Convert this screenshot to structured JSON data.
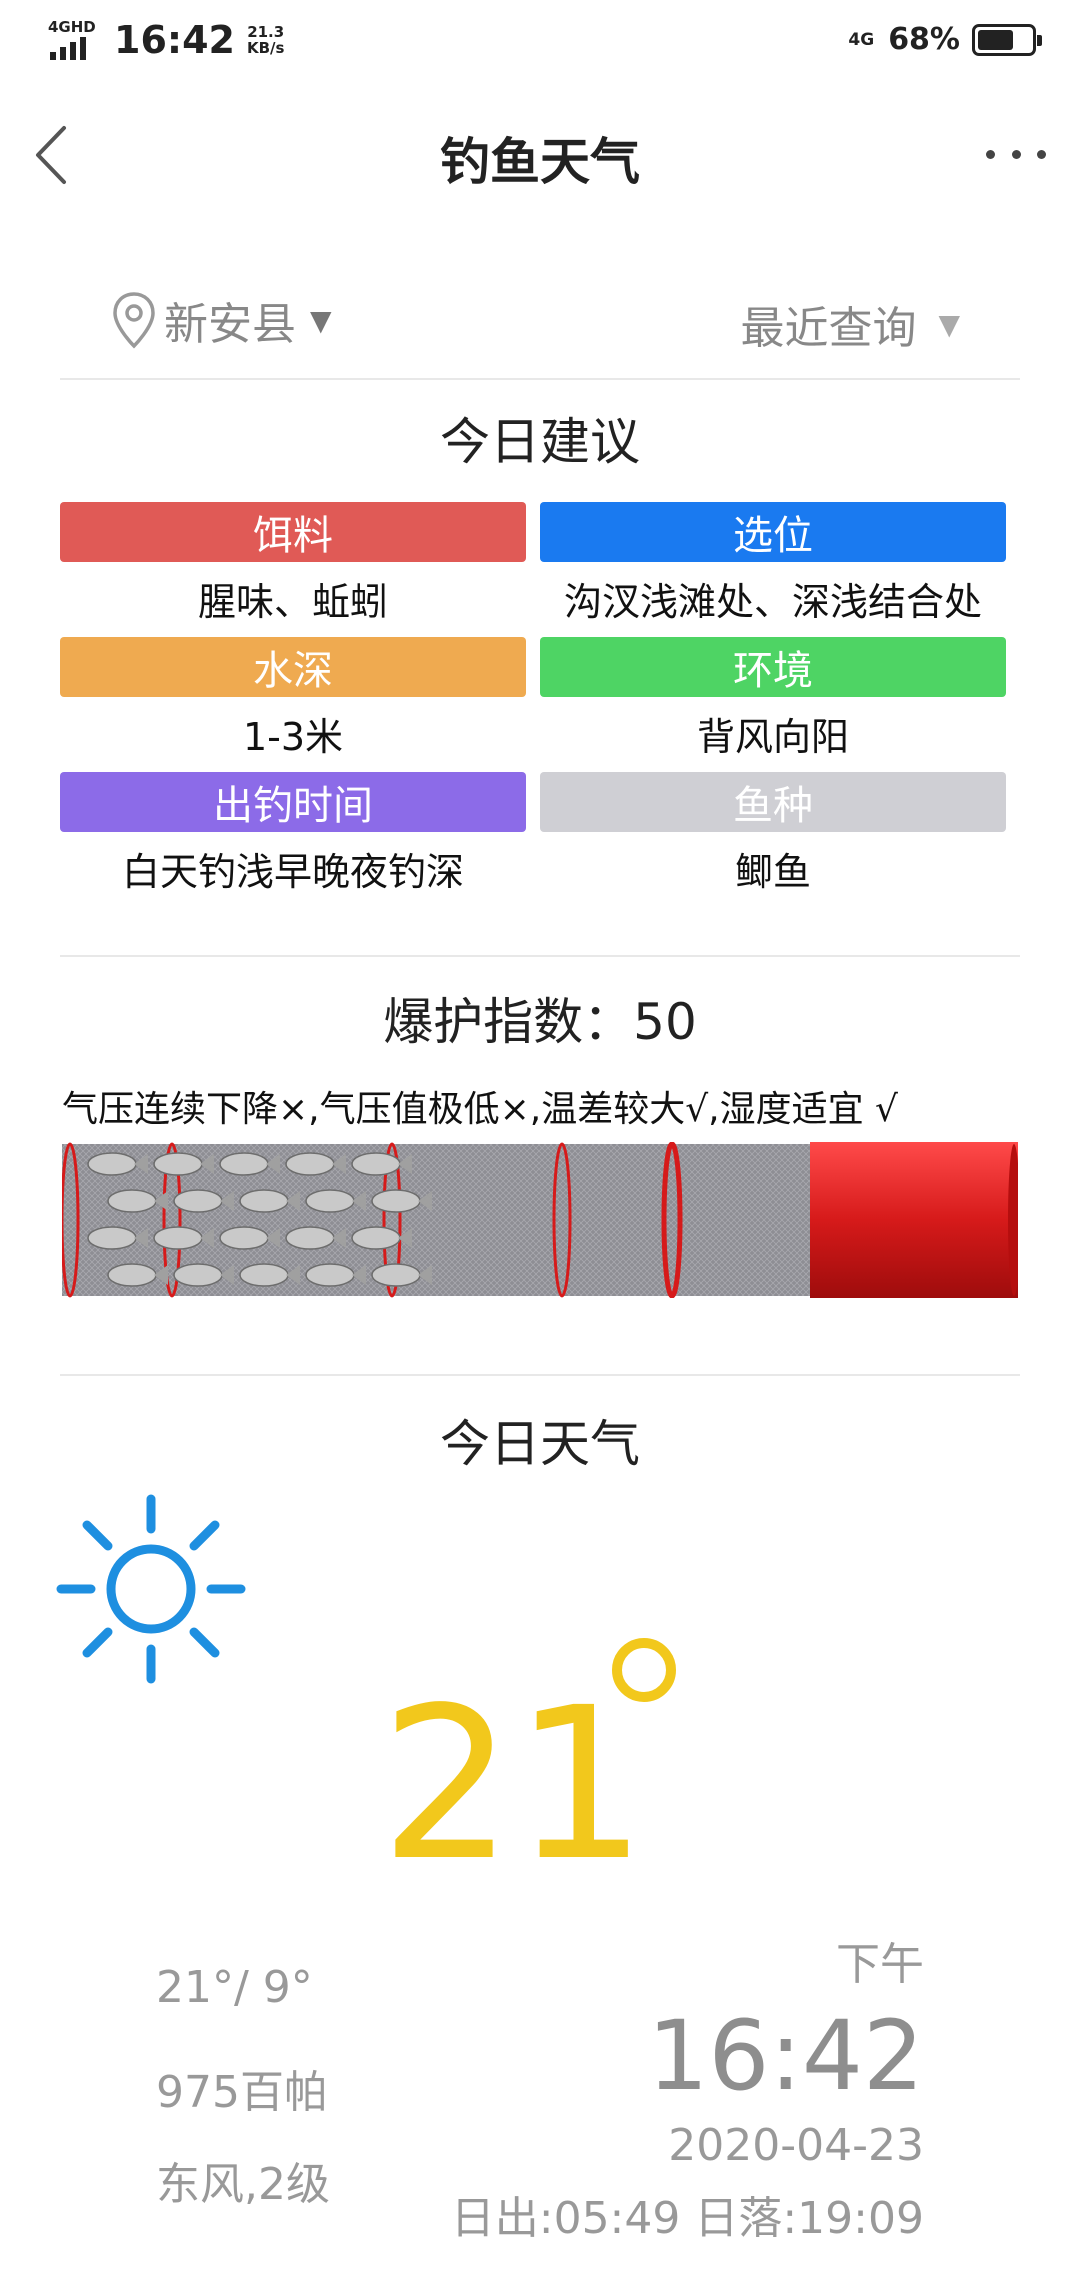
{
  "status_bar": {
    "network_left": "4GHD",
    "time": "16:42",
    "speed_value": "21.3",
    "speed_unit": "KB/s",
    "network_right": "4G",
    "battery": "68%",
    "battery_level": 0.68
  },
  "nav": {
    "title": "钓鱼天气",
    "back_icon": "chevron-left-icon",
    "more_icon": "more-dots-icon"
  },
  "location": {
    "city": "新安县",
    "recent": "最近查询"
  },
  "suggestions": {
    "title": "今日建议",
    "items": [
      {
        "label": "饵料",
        "value": "腥味、蚯蚓",
        "color": "#e05a56"
      },
      {
        "label": "选位",
        "value": "沟汊浅滩处、深浅结合处",
        "color": "#1a7af0"
      },
      {
        "label": "水深",
        "value": "1-3米",
        "color": "#efaa50"
      },
      {
        "label": "环境",
        "value": "背风向阳",
        "color": "#4ed464"
      },
      {
        "label": "出钓时间",
        "value": "白天钓浅早晚夜钓深",
        "color": "#8c6be8"
      },
      {
        "label": "鱼种",
        "value": "鲫鱼",
        "color": "#cfcfd4"
      }
    ]
  },
  "bite_index": {
    "title": "爆护指数：50",
    "description": "气压连续下降×,气压值极低×,温差较大√,湿度适宜 √",
    "fill_percent": 50
  },
  "weather": {
    "title": "今日天气",
    "icon": "sunny-icon",
    "temperature": "21",
    "high_low": "21°/ 9°",
    "pressure": "975百帕",
    "wind": "东风,2级",
    "period": "下午",
    "time": "16:42",
    "date": "2020-04-23",
    "sun_times": "日出:05:49 日落:19:09"
  },
  "colors": {
    "accent_yellow": "#f2c81c",
    "sun_blue": "#1e8fe0",
    "net_red": "#d61a1a"
  }
}
